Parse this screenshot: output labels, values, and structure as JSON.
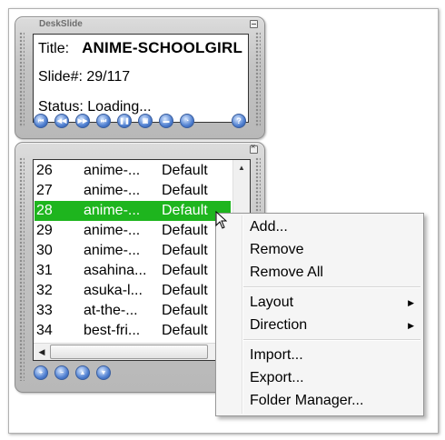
{
  "top_panel": {
    "window_title": "DeskSlide",
    "title_label": "Title:",
    "title_value": "ANIME-SCHOOLGIRL",
    "slide_label": "Slide#:",
    "slide_value": "29/117",
    "status_label": "Status:",
    "status_value": "Loading...",
    "controls": [
      {
        "name": "first-slide-button",
        "icon": "skip-back-icon",
        "glyph": "⏮"
      },
      {
        "name": "rewind-button",
        "icon": "rewind-icon",
        "glyph": "◀◀"
      },
      {
        "name": "fast-forward-button",
        "icon": "fast-forward-icon",
        "glyph": "▶▶"
      },
      {
        "name": "last-slide-button",
        "icon": "skip-forward-icon",
        "glyph": "⏭"
      },
      {
        "name": "pause-button",
        "icon": "pause-icon",
        "glyph": "❚❚"
      },
      {
        "name": "copy-button",
        "icon": "copy-icon",
        "glyph": "▣"
      },
      {
        "name": "folder-button",
        "icon": "folder-icon",
        "glyph": "▬"
      },
      {
        "name": "timer-button",
        "icon": "clock-icon",
        "glyph": "◔"
      }
    ],
    "help_glyph": "?"
  },
  "playlist": {
    "rows": [
      {
        "num": "26",
        "name": "anime-...",
        "type": "Default",
        "selected": false
      },
      {
        "num": "27",
        "name": "anime-...",
        "type": "Default",
        "selected": false
      },
      {
        "num": "28",
        "name": "anime-...",
        "type": "Default",
        "selected": true
      },
      {
        "num": "29",
        "name": "anime-...",
        "type": "Default",
        "selected": false
      },
      {
        "num": "30",
        "name": "anime-...",
        "type": "Default",
        "selected": false
      },
      {
        "num": "31",
        "name": "asahina...",
        "type": "Default",
        "selected": false
      },
      {
        "num": "32",
        "name": "asuka-l...",
        "type": "Default",
        "selected": false
      },
      {
        "num": "33",
        "name": "at-the-...",
        "type": "Default",
        "selected": false
      },
      {
        "num": "34",
        "name": "best-fri...",
        "type": "Default",
        "selected": false
      }
    ],
    "bottom_buttons": [
      {
        "name": "add-item-button",
        "icon": "plus-icon",
        "glyph": "+"
      },
      {
        "name": "remove-item-button",
        "icon": "minus-icon",
        "glyph": "−"
      },
      {
        "name": "move-up-button",
        "icon": "arrow-up-icon",
        "glyph": "▲"
      },
      {
        "name": "move-down-button",
        "icon": "arrow-down-icon",
        "glyph": "▼"
      }
    ]
  },
  "context_menu": {
    "items": [
      {
        "label": "Add...",
        "submenu": false
      },
      {
        "label": "Remove",
        "submenu": false
      },
      {
        "label": "Remove All",
        "submenu": false
      },
      {
        "label": "Layout",
        "submenu": true
      },
      {
        "label": "Direction",
        "submenu": true
      },
      {
        "label": "Import...",
        "submenu": false
      },
      {
        "label": "Export...",
        "submenu": false
      },
      {
        "label": "Folder Manager...",
        "submenu": false
      }
    ]
  },
  "colors": {
    "selection": "#1eb51e",
    "button_blue": "#4f7fd0"
  }
}
